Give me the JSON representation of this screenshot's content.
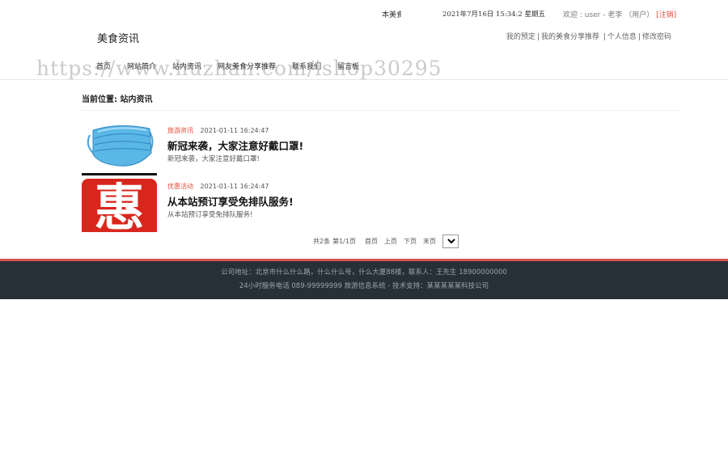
{
  "topbar": {
    "marquee": "本美食",
    "datetime": "2021年7月16日  15:34:2  星期五",
    "welcome_prefix": "欢迎 : user - 老李 （用户）",
    "logout": "[注销]"
  },
  "header": {
    "logo": "美食资讯",
    "user_links": [
      "我的预定",
      "我的美食分享推荐",
      "个人信息",
      "修改密码"
    ]
  },
  "nav": {
    "items": [
      "首页",
      "网站简介",
      "站内资讯",
      "网友美食分享推荐",
      "联系我们",
      "留言板"
    ]
  },
  "watermark": "https://www.huzhan.com/ishop30295",
  "breadcrumb": "当前位置: 站内资讯",
  "news": [
    {
      "thumb_icon": "face-mask-image",
      "category": "旅游资讯",
      "date": "2021-01-11 16:24:47",
      "title": "新冠来袭，大家注意好戴口罩!",
      "summary": "新冠来袭，大家注意好戴口罩!"
    },
    {
      "thumb_icon": "hui-discount-image",
      "thumb_char": "惠",
      "category": "优惠活动",
      "date": "2021-01-11 16:24:47",
      "title": "从本站预订享受免排队服务!",
      "summary": "从本站预订享受免排队服务!"
    }
  ],
  "pager": {
    "total": "共2条",
    "page_info": "第1/1页",
    "first": "首页",
    "prev": "上页",
    "next": "下页",
    "last": "末页",
    "selected_page": "1"
  },
  "footer": {
    "line1": "公司地址：北京市什么什么路，什么什么号，什么大厦88楼，联系人：王先生 18900000000",
    "line2": "24小时服务电话   089-99999999   旅游信息系统 - 技术支持：某某某某某科技公司"
  },
  "colors": {
    "accent_red": "#e74c3c",
    "footer_bg": "#273039",
    "footer_border": "#d9534f"
  }
}
